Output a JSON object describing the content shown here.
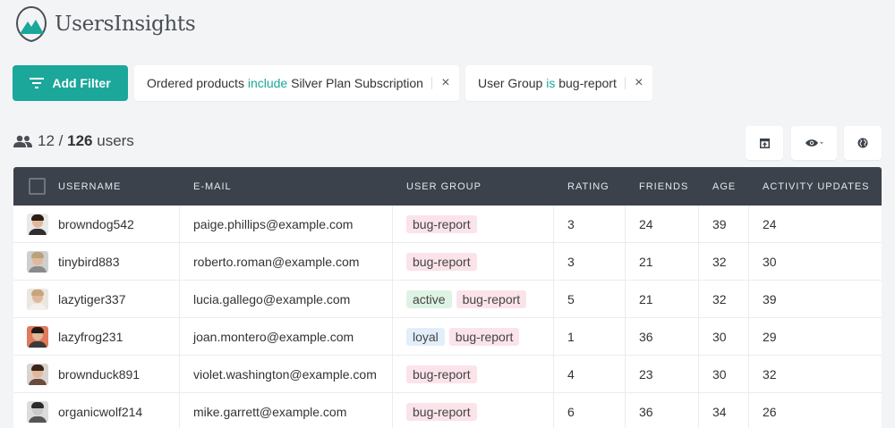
{
  "app": {
    "name": "UsersInsights"
  },
  "filters": {
    "add_label": "Add Filter",
    "chips": [
      {
        "field": "Ordered products",
        "operator": "include",
        "value": "Silver Plan Subscription"
      },
      {
        "field": "User Group",
        "operator": "is",
        "value": "bug-report"
      }
    ],
    "remove_symbol": "×"
  },
  "summary": {
    "shown": "12",
    "separator": "/",
    "total": "126",
    "unit": "users"
  },
  "icons": {
    "users": "users-icon",
    "filter": "filter-icon",
    "export": "export-icon",
    "visibility": "eye-icon",
    "map": "globe-icon",
    "close": "close-icon"
  },
  "colors": {
    "accent": "#1ba79a",
    "header_bg": "#3b424b",
    "tag_bug": "#fbe3ea",
    "tag_active": "#def3e3",
    "tag_loyal": "#e2effa"
  },
  "table": {
    "columns": [
      "Username",
      "E-mail",
      "User Group",
      "Rating",
      "Friends",
      "Age",
      "Activity Updates"
    ],
    "rows": [
      {
        "username": "browndog542",
        "email": "paige.phillips@example.com",
        "groups": [
          "bug-report"
        ],
        "rating": "3",
        "friends": "24",
        "age": "39",
        "activity": "24"
      },
      {
        "username": "tinybird883",
        "email": "roberto.roman@example.com",
        "groups": [
          "bug-report"
        ],
        "rating": "3",
        "friends": "21",
        "age": "32",
        "activity": "30"
      },
      {
        "username": "lazytiger337",
        "email": "lucia.gallego@example.com",
        "groups": [
          "active",
          "bug-report"
        ],
        "rating": "5",
        "friends": "21",
        "age": "32",
        "activity": "39"
      },
      {
        "username": "lazyfrog231",
        "email": "joan.montero@example.com",
        "groups": [
          "loyal",
          "bug-report"
        ],
        "rating": "1",
        "friends": "36",
        "age": "30",
        "activity": "29"
      },
      {
        "username": "brownduck891",
        "email": "violet.washington@example.com",
        "groups": [
          "bug-report"
        ],
        "rating": "4",
        "friends": "23",
        "age": "30",
        "activity": "32"
      },
      {
        "username": "organicwolf214",
        "email": "mike.garrett@example.com",
        "groups": [
          "bug-report"
        ],
        "rating": "6",
        "friends": "36",
        "age": "34",
        "activity": "26"
      }
    ]
  }
}
